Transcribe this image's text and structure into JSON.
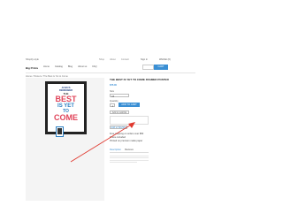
{
  "header": {
    "logo": "Shopify-style",
    "store_name": "Big Prints",
    "top_links": [
      "Shop",
      "About",
      "Contact"
    ],
    "main_nav": [
      "Home",
      "Catalog",
      "Blog",
      "About us",
      "FAQ"
    ],
    "signin": "Sign in",
    "wishlist": "Wishlist (0)",
    "cart": "CART",
    "breadcrumb": "Home / Posters / The Best is Yet to Come"
  },
  "product": {
    "title": "THE BEST IS YET TO COME FRAMED POSTER",
    "price": "$75.00",
    "size_label": "Size",
    "size_value": "A3",
    "quantity_label": "Quantity",
    "quantity_value": "1",
    "add_to_cart": "ADD TO CART",
    "wishlist_button": "Add to wishlist",
    "promo_button": "Add to Wishlist",
    "bullets": [
      "Free shipping on orders over $50",
      "Frame included",
      "Printed on premium matte paper"
    ],
    "tabs": [
      "Description",
      "Reviews"
    ]
  },
  "poster": {
    "lines": [
      {
        "text": "ALWAYS",
        "color": "#2b4a8a",
        "size": 2.4
      },
      {
        "text": "REMEMBER",
        "color": "#2b4a8a",
        "size": 2.6
      },
      {
        "text": "THE",
        "color": "#333333",
        "size": 3
      },
      {
        "text": "BEST",
        "color": "#e0445a",
        "size": 9
      },
      {
        "text": "IS YET",
        "color": "#2b7fc2",
        "size": 6
      },
      {
        "text": "TO",
        "color": "#2b7fc2",
        "size": 5
      },
      {
        "text": "COME",
        "color": "#e0445a",
        "size": 9
      }
    ]
  },
  "colors": {
    "accent": "#3a8fd4",
    "arrow": "#e0392f"
  }
}
